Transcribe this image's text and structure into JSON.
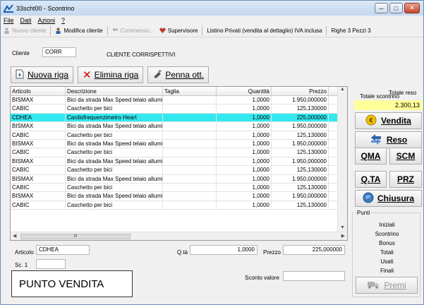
{
  "window": {
    "title": "33scht00 - Scontrino",
    "controls": [
      "─",
      "□",
      "✕"
    ]
  },
  "menu": [
    "File",
    "Dati",
    "Azioni",
    "?"
  ],
  "toolbar": {
    "nuovo_cliente": "Nuovo cliente",
    "modifica_cliente": "Modifica cliente",
    "commesso": "Commesso...",
    "supervisore": "Supervisore",
    "listino": "Listino Privati (vendita al dettaglio) IVA inclusa",
    "righe_pezzi": "Righe 3 Pezzi 3"
  },
  "client": {
    "label": "Cliente",
    "code": "CORR",
    "name": "CLIENTE CORRISPETTIVI"
  },
  "actions": {
    "nuova_riga": "Nuova riga",
    "elimina_riga": "Elimina riga",
    "penna_ott": "Penna ott."
  },
  "totale_reso_label": "Totale reso",
  "grid": {
    "columns": [
      "Articolo",
      "Descrizione",
      "Taglia",
      "Quantità",
      "Prezzo"
    ],
    "rows": [
      [
        "BISMAX",
        "Bici da strada Max Speed telaio allumi",
        "",
        "1,0000",
        "1.950,000000"
      ],
      [
        "CABIC",
        "Caschetto per bici",
        "",
        "1,0000",
        "125,130000"
      ],
      [
        "CDHEA",
        "Cardiofrequenzimetro Heart",
        "",
        "1,0000",
        "225,000000"
      ],
      [
        "BISMAX",
        "Bici da strada Max Speed telaio allumi",
        "",
        "1,0000",
        "1.950,000000"
      ],
      [
        "CABIC",
        "Caschetto per bici",
        "",
        "1,0000",
        "125,130000"
      ],
      [
        "BISMAX",
        "Bici da strada Max Speed telaio allumi",
        "",
        "1,0000",
        "1.950,000000"
      ],
      [
        "CABIC",
        "Caschetto per bici",
        "",
        "1,0000",
        "125,130000"
      ],
      [
        "BISMAX",
        "Bici da strada Max Speed telaio allumi",
        "",
        "1,0000",
        "1.950,000000"
      ],
      [
        "CABIC",
        "Caschetto per bici",
        "",
        "1,0000",
        "125,130000"
      ],
      [
        "BISMAX",
        "Bici da strada Max Speed telaio allumi",
        "",
        "1,0000",
        "1.950,000000"
      ],
      [
        "CABIC",
        "Caschetto per bici",
        "",
        "1,0000",
        "125,130000"
      ],
      [
        "BISMAX",
        "Bici da strada Max Speed telaio allumi",
        "",
        "1,0000",
        "1.950,000000"
      ],
      [
        "CABIC",
        "Caschetto per bici",
        "",
        "1,0000",
        "125,130000"
      ]
    ],
    "selected_row": 2,
    "scroll_glyph": "III"
  },
  "right": {
    "totale_scontrino_label": "Totale scontrino",
    "totale_scontrino_value": "2.300,13",
    "vendita": "Vendita",
    "reso": "Reso",
    "qma": "QMA",
    "scm": "SCM",
    "qta": "Q.TA",
    "prz": "PRZ",
    "chiusura": "Chiusura",
    "premi": "Premi"
  },
  "punti": {
    "title": "Punti",
    "lines": [
      "Iniziali",
      "Scontrino",
      "Bonus",
      "Totali",
      "Usati",
      "Finali"
    ]
  },
  "bottom": {
    "articolo_label": "Articolo",
    "articolo_value": "CDHEA",
    "qta_label": "Q.tà",
    "qta_value": "1,0000",
    "prezzo_label": "Prezzo",
    "prezzo_value": "225,000000",
    "sc1_label": "Sc. 1",
    "sconto_valore_label": "Sconto valore"
  },
  "punto_vendita": "PUNTO VENDITA",
  "colors": {
    "selected_row": "#34e8f0",
    "total_bg": "#ffff99"
  }
}
